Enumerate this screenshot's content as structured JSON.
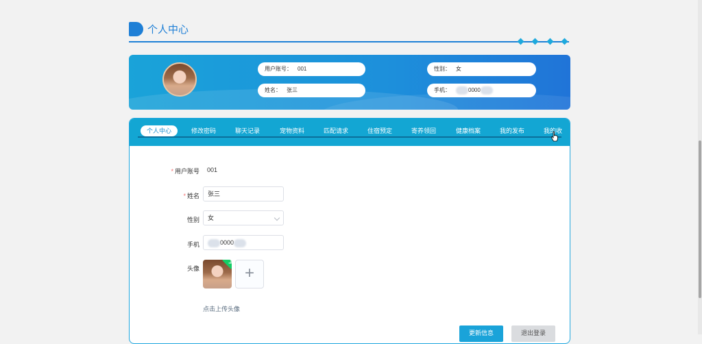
{
  "header": {
    "title": "个人中心"
  },
  "profile": {
    "account_label": "用户账号：",
    "account_value": "001",
    "name_label": "姓名：",
    "name_value": "张三",
    "gender_label": "性别：",
    "gender_value": "女",
    "phone_label": "手机：",
    "phone_value": "0000"
  },
  "tabs": [
    {
      "label": "个人中心"
    },
    {
      "label": "修改密码"
    },
    {
      "label": "聊天记录"
    },
    {
      "label": "宠物资料"
    },
    {
      "label": "匹配请求"
    },
    {
      "label": "住宿预定"
    },
    {
      "label": "寄养领回"
    },
    {
      "label": "健康档案"
    },
    {
      "label": "我的发布"
    },
    {
      "label": "我的收"
    }
  ],
  "form": {
    "account_label": "用户账号",
    "account_value": "001",
    "name_label": "姓名",
    "name_value": "张三",
    "gender_label": "性别",
    "gender_value": "女",
    "phone_label": "手机",
    "phone_value": "0000",
    "avatar_label": "头像",
    "upload_hint": "点击上传头像",
    "required_mark": "*",
    "plus": "+"
  },
  "buttons": {
    "update": "更新信息",
    "logout": "退出登录"
  },
  "colors": {
    "primary": "#1aa3d9",
    "brand_blue": "#1e7fd6",
    "required": "#f56c6c",
    "success": "#13ce66"
  }
}
